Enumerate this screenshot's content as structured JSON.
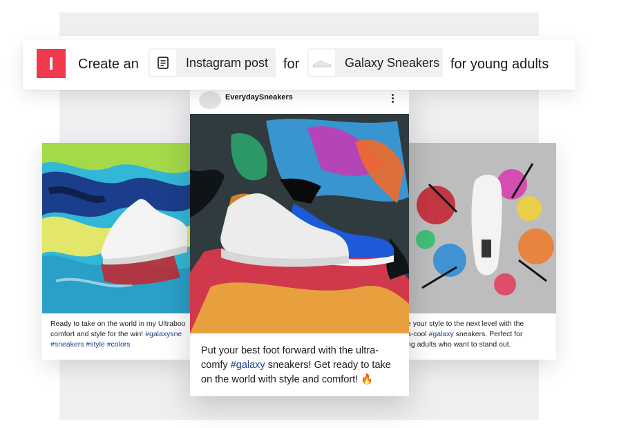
{
  "prompt": {
    "text_create": "Create an",
    "chip_post_label": "Instagram post",
    "post_icon": "document-icon",
    "text_for": "for",
    "chip_product_label": "Galaxy Sneakers",
    "product_icon": "sneaker-thumbnail-icon",
    "text_audience": "for young adults"
  },
  "left_card": {
    "caption_line1": "Ready to take on the world in my Ultraboo",
    "caption_line2_text": "comfort and style for the win! ",
    "caption_line2_tag": "#galaxysne",
    "caption_line3_tags": "#sneakers #style #colors"
  },
  "main_card": {
    "username": "EverydaySneakers",
    "caption_part1": "Put your best foot forward with the ultra-comfy ",
    "caption_tag": "#galaxy",
    "caption_part2": " sneakers! Get ready to take on the world with style and comfort! 🔥"
  },
  "right_card": {
    "caption_line1": "e your style to the next level with the",
    "caption_line2_text_a": "a-cool ",
    "caption_line2_tag": "#galaxy",
    "caption_line2_text_b": " sneakers. Perfect for",
    "caption_line3": "ng adults who want to stand out."
  },
  "colors": {
    "brand_red": "#ee3a4b",
    "hashtag_blue": "#1f3f8a",
    "panel_gray": "#efeff1"
  }
}
